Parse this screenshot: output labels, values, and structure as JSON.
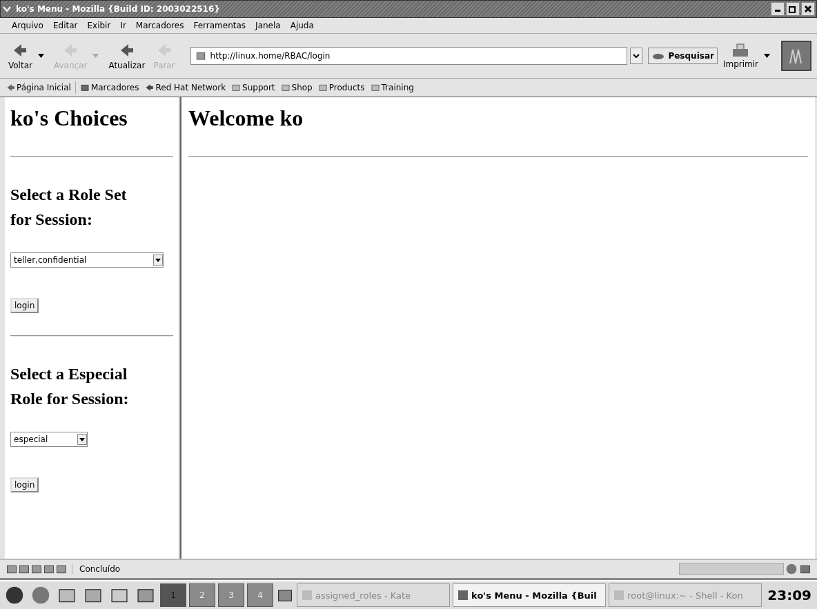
{
  "window": {
    "title": "ko's Menu - Mozilla {Build ID: 2003022516}"
  },
  "menu": [
    "Arquivo",
    "Editar",
    "Exibir",
    "Ir",
    "Marcadores",
    "Ferramentas",
    "Janela",
    "Ajuda"
  ],
  "toolbar": [
    {
      "label": "Voltar",
      "disabled": false,
      "dropdown": true
    },
    {
      "label": "Avançar",
      "disabled": true,
      "dropdown": true
    },
    {
      "label": "Atualizar",
      "disabled": false,
      "dropdown": false
    },
    {
      "label": "Parar",
      "disabled": true,
      "dropdown": false
    }
  ],
  "url": "http://linux.home/RBAC/login",
  "search_button": "Pesquisar",
  "print_button": "Imprimir",
  "bookmarks": [
    {
      "label": "Página Inicial",
      "kind": "home"
    },
    {
      "label": "Marcadores",
      "kind": "bookmarks"
    },
    {
      "label": "Red Hat Network",
      "kind": "link"
    },
    {
      "label": "Support",
      "kind": "folder"
    },
    {
      "label": "Shop",
      "kind": "folder"
    },
    {
      "label": "Products",
      "kind": "folder"
    },
    {
      "label": "Training",
      "kind": "folder"
    }
  ],
  "sidebar": {
    "title": "ko's Choices",
    "sections": [
      {
        "heading": "Select a Role Set for Session:",
        "select": "teller,confidential",
        "wide": true,
        "button": "login"
      },
      {
        "heading": "Select a Especial Role for Session:",
        "select": "especial",
        "wide": false,
        "button": "login"
      }
    ]
  },
  "main": {
    "heading": "Welcome ko"
  },
  "status_bar": {
    "text": "Concluído"
  },
  "taskbar": {
    "desktops": [
      {
        "label": "1",
        "selected": true
      },
      {
        "label": "2",
        "selected": false
      },
      {
        "label": "3",
        "selected": false
      },
      {
        "label": "4",
        "selected": false
      }
    ],
    "tasks": [
      {
        "label": "assigned_roles - Kate",
        "selected": false
      },
      {
        "label": "ko's Menu - Mozilla {Buil",
        "selected": true
      },
      {
        "label": "root@linux:~ - Shell - Kon",
        "selected": false
      }
    ],
    "clock": "23:09"
  }
}
